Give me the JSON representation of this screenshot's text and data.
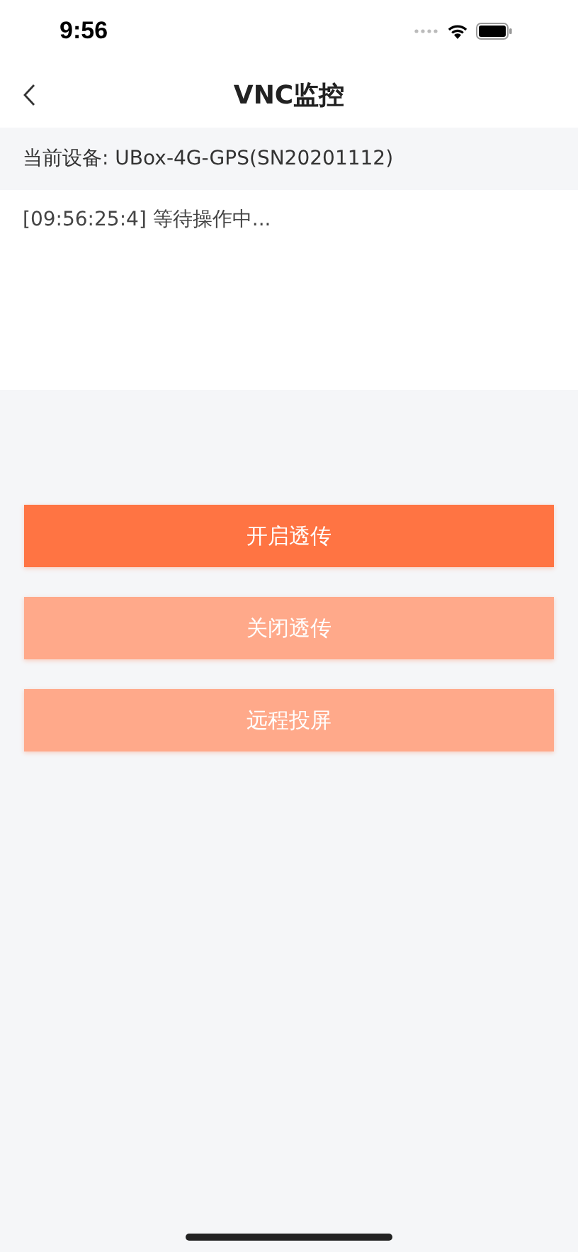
{
  "status_bar": {
    "time": "9:56"
  },
  "nav": {
    "title": "VNC监控"
  },
  "device": {
    "text": "当前设备: UBox-4G-GPS(SN20201112)"
  },
  "log": [
    "[09:56:25:4] 等待操作中..."
  ],
  "buttons": [
    {
      "label": "开启透传",
      "disabled": false
    },
    {
      "label": "关闭透传",
      "disabled": true
    },
    {
      "label": "远程投屏",
      "disabled": true
    }
  ]
}
